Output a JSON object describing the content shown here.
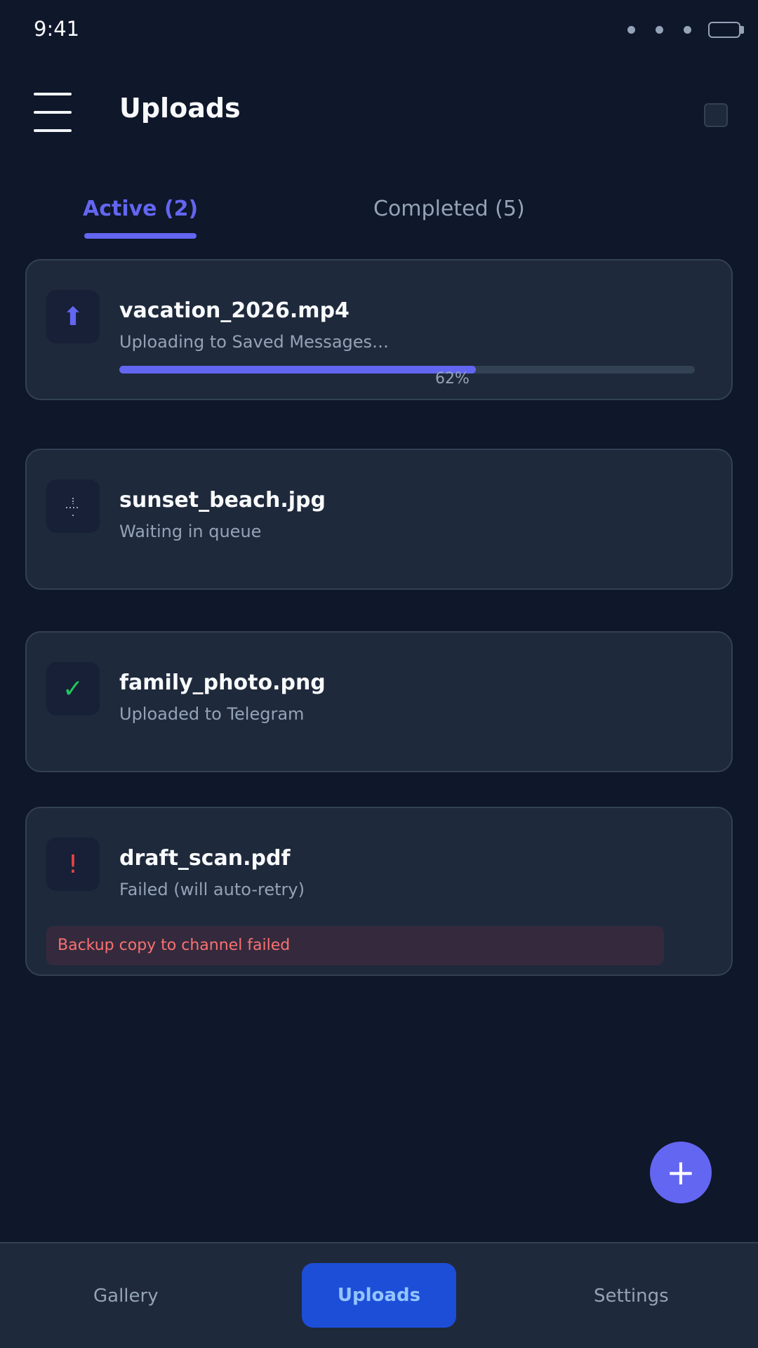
{
  "status_bar": {
    "time": "9:41"
  },
  "header": {
    "title": "Uploads"
  },
  "tabs": [
    {
      "label": "Active (2)",
      "active": true
    },
    {
      "label": "Completed (5)",
      "active": false
    }
  ],
  "uploads": [
    {
      "file_name": "vacation_2026.mp4",
      "status": "Uploading to Saved Messages…",
      "icon": "upload-arrow-icon",
      "glyph": "⬆",
      "progress": 62,
      "progress_label": "62%"
    },
    {
      "file_name": "sunset_beach.jpg",
      "status": "Waiting in queue",
      "icon": "hourglass-icon"
    },
    {
      "file_name": "family_photo.png",
      "status": "Uploaded to Telegram",
      "icon": "checkmark-icon",
      "glyph": "✓"
    },
    {
      "file_name": "draft_scan.pdf",
      "status": "Failed (will auto-retry)",
      "icon": "error-icon",
      "glyph": "!",
      "error": "Backup copy to channel failed"
    }
  ],
  "fab": {
    "glyph": "+"
  },
  "bottom_nav": [
    {
      "label": "Gallery",
      "active": false
    },
    {
      "label": "Uploads",
      "active": true
    },
    {
      "label": "Settings",
      "active": false
    }
  ],
  "colors": {
    "background": "#0f172a",
    "card": "#1e293b",
    "accent": "#6366f1",
    "success": "#22c55e",
    "error": "#ef4444",
    "nav_active": "#1d4ed8"
  }
}
